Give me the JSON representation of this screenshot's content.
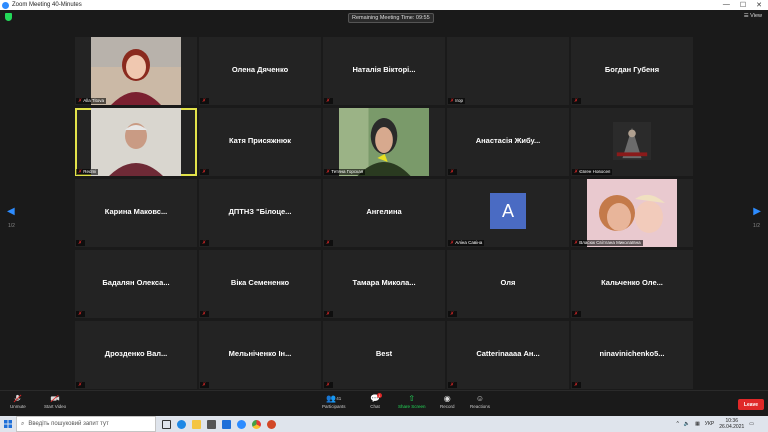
{
  "window": {
    "title": "Zoom Meeting 40-Minutes",
    "minimize": "—",
    "maximize": "☐",
    "close": "✕"
  },
  "meeting": {
    "timer": "Remaining Meeting Time: 09:55",
    "view_label": "View",
    "page_left": "1/2",
    "page_right": "1/2"
  },
  "tiles": [
    {
      "label": "Alla Titova",
      "video": "woman-red-hair",
      "active": false
    },
    {
      "name": "Олена Дяченко",
      "label": ""
    },
    {
      "name": "Наталія Вікторі...",
      "label": ""
    },
    {
      "label": "Ігор",
      "video": "none"
    },
    {
      "name": "Богдан Губеня",
      "label": ""
    },
    {
      "label": "Redmi",
      "video": "older-man",
      "active": true
    },
    {
      "name": "Катя Присяжнюк",
      "label": ""
    },
    {
      "label": "Тетяна Горская",
      "video": "woman-hand-chin"
    },
    {
      "name": "Анастасія Жибу...",
      "label": ""
    },
    {
      "label": "Євген Новосел",
      "video": "game-poster"
    },
    {
      "name": "Карина Маковс...",
      "label": ""
    },
    {
      "name": "ДПТНЗ \"Білоце...",
      "label": ""
    },
    {
      "name": "Ангелина",
      "label": ""
    },
    {
      "label": "Аліна Савіна",
      "avatar": "A"
    },
    {
      "label": "Власюк Світлана Миколаївна",
      "video": "woman-child"
    },
    {
      "name": "Бадалян Олекса...",
      "label": ""
    },
    {
      "name": "Віка Семененко",
      "label": ""
    },
    {
      "name": "Тамара Микола...",
      "label": ""
    },
    {
      "name": "Оля",
      "label": ""
    },
    {
      "name": "Кальченко Оле...",
      "label": ""
    },
    {
      "name": "Дрозденко Вал...",
      "label": ""
    },
    {
      "name": "Мельніченко Ін...",
      "label": ""
    },
    {
      "name": "Best",
      "label": ""
    },
    {
      "name": "Catterinaaaa Ан...",
      "label": ""
    },
    {
      "name": "ninavinichenko5...",
      "label": ""
    }
  ],
  "toolbar": {
    "unmute": "Unmute",
    "start_video": "Start Video",
    "participants": "Participants",
    "participants_count": "41",
    "chat": "Chat",
    "chat_badge": "1",
    "share_screen": "Share Screen",
    "record": "Record",
    "reactions": "Reactions",
    "leave": "Leave"
  },
  "taskbar": {
    "search_placeholder": "Введіть пошуковий запит тут",
    "lang": "УКР",
    "time": "10:36",
    "date": "26.04.2021"
  },
  "colors": {
    "accent": "#2d8cff",
    "active_speaker": "#e2e24a",
    "leave": "#e02828",
    "share": "#23d959"
  }
}
